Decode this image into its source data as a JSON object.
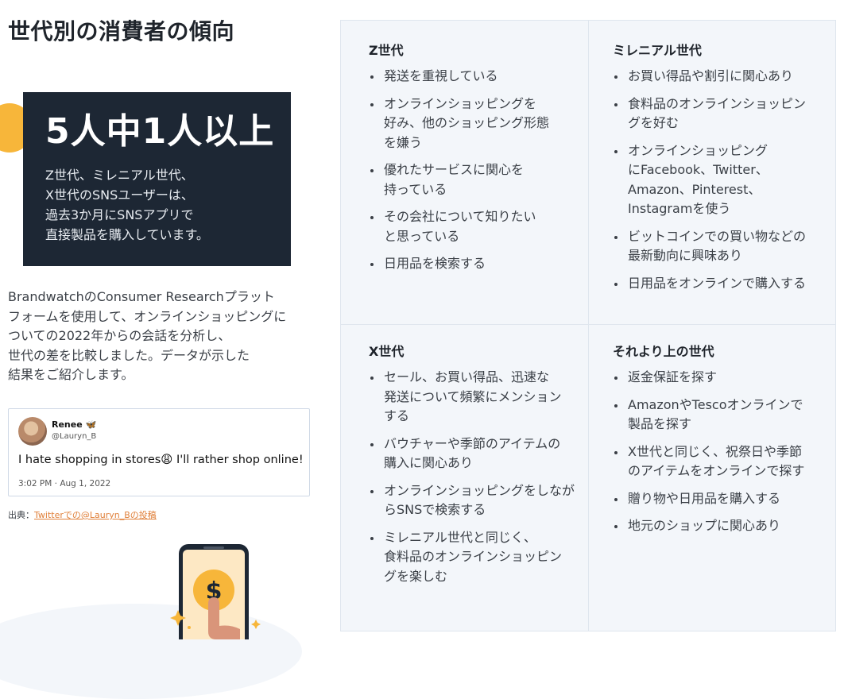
{
  "title": "世代別の消費者の傾向",
  "stat": {
    "headline": "5人中1人以上",
    "lines": [
      "Z世代、ミレニアル世代、",
      "X世代のSNSユーザーは、",
      "過去3か月にSNSアプリで",
      "直接製品を購入しています。"
    ]
  },
  "description": [
    "BrandwatchのConsumer Researchプラット",
    "フォームを使用して、オンラインショッピングに",
    "ついての2022年からの会話を分析し、",
    "世代の差を比較しました。データが示した",
    "結果をご紹介します。"
  ],
  "tweet": {
    "name": "Renee 🦋",
    "handle": "@Lauryn_B",
    "text": "I hate shopping in stores😩 I'll rather shop online!",
    "time": "3:02 PM · Aug 1, 2022"
  },
  "source": {
    "prefix": "出典：",
    "link_text": "Twitterでの@Lauryn_Bの投稿"
  },
  "cells": [
    {
      "heading": "Z世代",
      "items": [
        "発送を重視している",
        "オンラインショッピングを\n好み、他のショッピング形態\nを嫌う",
        "優れたサービスに関心を\n持っている",
        "その会社について知りたい\nと思っている",
        "日用品を検索する"
      ]
    },
    {
      "heading": "ミレニアル世代",
      "items": [
        "お買い得品や割引に関心あり",
        "食料品のオンラインショッピン\nグを好む",
        "オンラインショッピング\nにFacebook、Twitter、\nAmazon、Pinterest、\nInstagramを使う",
        "ビットコインでの買い物などの\n最新動向に興味あり",
        "日用品をオンラインで購入する"
      ]
    },
    {
      "heading": "X世代",
      "items": [
        "セール、お買い得品、迅速な\n発送について頻繁にメンション\nする",
        "バウチャーや季節のアイテムの\n購入に関心あり",
        "オンラインショッピングをしなが\nらSNSで検索する",
        "ミレニアル世代と同じく、\n食料品のオンラインショッピン\nグを楽しむ"
      ]
    },
    {
      "heading": "それより上の世代",
      "items": [
        "返金保証を探す",
        "AmazonやTescoオンラインで\n製品を探す",
        "X世代と同じく、祝祭日や季節\nのアイテムをオンラインで探す",
        "贈り物や日用品を購入する",
        "地元のショップに関心あり"
      ]
    }
  ],
  "colors": {
    "accent": "#f7b63a",
    "dark_box": "#1d2734",
    "link": "#e0803a",
    "panel": "#f3f6fa"
  },
  "phone_symbol": "$"
}
